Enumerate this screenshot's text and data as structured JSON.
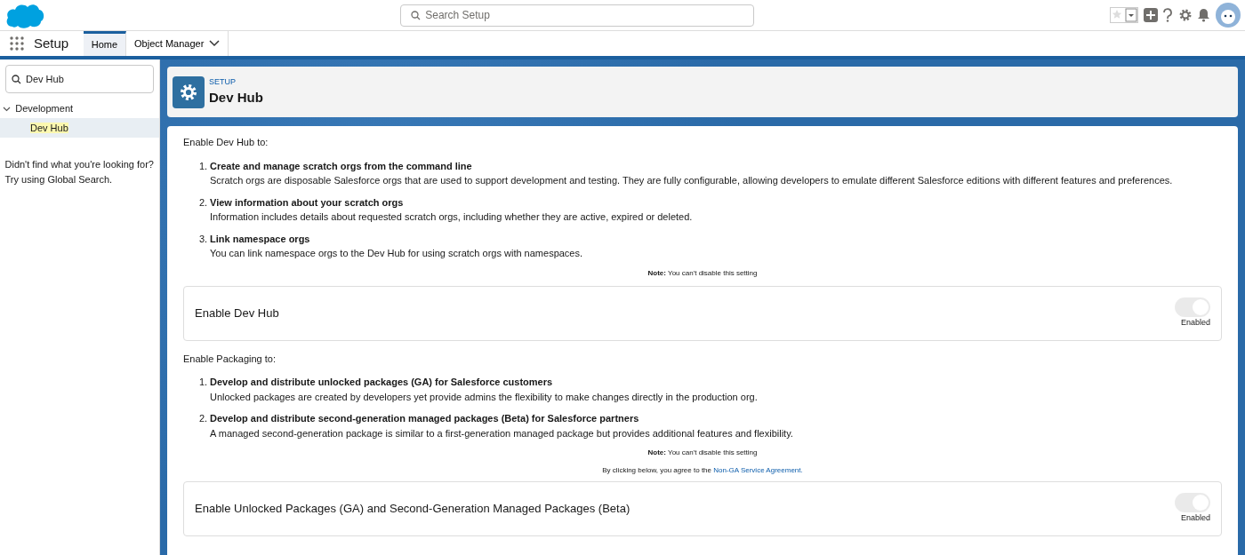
{
  "header": {
    "search": {
      "placeholder": "Search Setup"
    }
  },
  "nav": {
    "app_name": "Setup",
    "tabs": [
      {
        "label": "Home",
        "selected": true,
        "dropdown": false
      },
      {
        "label": "Object Manager",
        "selected": false,
        "dropdown": true
      }
    ]
  },
  "sidebar": {
    "search": {
      "value": "Dev Hub"
    },
    "tree": [
      {
        "label": "Development",
        "expanded": true,
        "children": [
          {
            "label": "Dev Hub",
            "selected": true
          }
        ]
      }
    ],
    "help": [
      "Didn't find what you're looking for?",
      "Try using Global Search."
    ]
  },
  "page_header": {
    "eyebrow": "SETUP",
    "title": "Dev Hub"
  },
  "sections": [
    {
      "intro": "Enable Dev Hub to:",
      "items": [
        {
          "number": "1.",
          "title": "Create and manage scratch orgs from the command line",
          "text": "Scratch orgs are disposable Salesforce orgs that are used to support development and testing. They are fully configurable, allowing developers to emulate different Salesforce editions with different features and preferences."
        },
        {
          "number": "2.",
          "title": "View information about your scratch orgs",
          "text": "Information includes details about requested scratch orgs, including whether they are active, expired or deleted."
        },
        {
          "number": "3.",
          "title": "Link namespace orgs",
          "text": "You can link namespace orgs to the Dev Hub for using scratch orgs with namespaces."
        }
      ],
      "note": "**Note:** You can't disable this setting",
      "setting": {
        "label": "Enable Dev Hub",
        "on": true,
        "disabled": true,
        "status": "Enabled"
      }
    },
    {
      "intro": "Enable Packaging to:",
      "items": [
        {
          "number": "1.",
          "title": "Develop and distribute unlocked packages (GA) for Salesforce customers",
          "text": "Unlocked packages are created by developers yet provide admins the flexibility to make changes directly in the production org."
        },
        {
          "number": "2.",
          "title": "Develop and distribute second-generation managed packages (Beta) for Salesforce partners",
          "text": "A managed second-generation package is similar to a first-generation managed package but provides additional features and flexibility."
        }
      ],
      "note": "**Note:** You can't disable this setting",
      "agreement": {
        "text": "By clicking below, you agree to the",
        "link": "Non-GA Service Agreement."
      },
      "setting": {
        "label": "Enable Unlocked Packages (GA) and Second-Generation Managed Packages (Beta)",
        "on": true,
        "disabled": true,
        "status": "Enabled"
      }
    }
  ]
}
